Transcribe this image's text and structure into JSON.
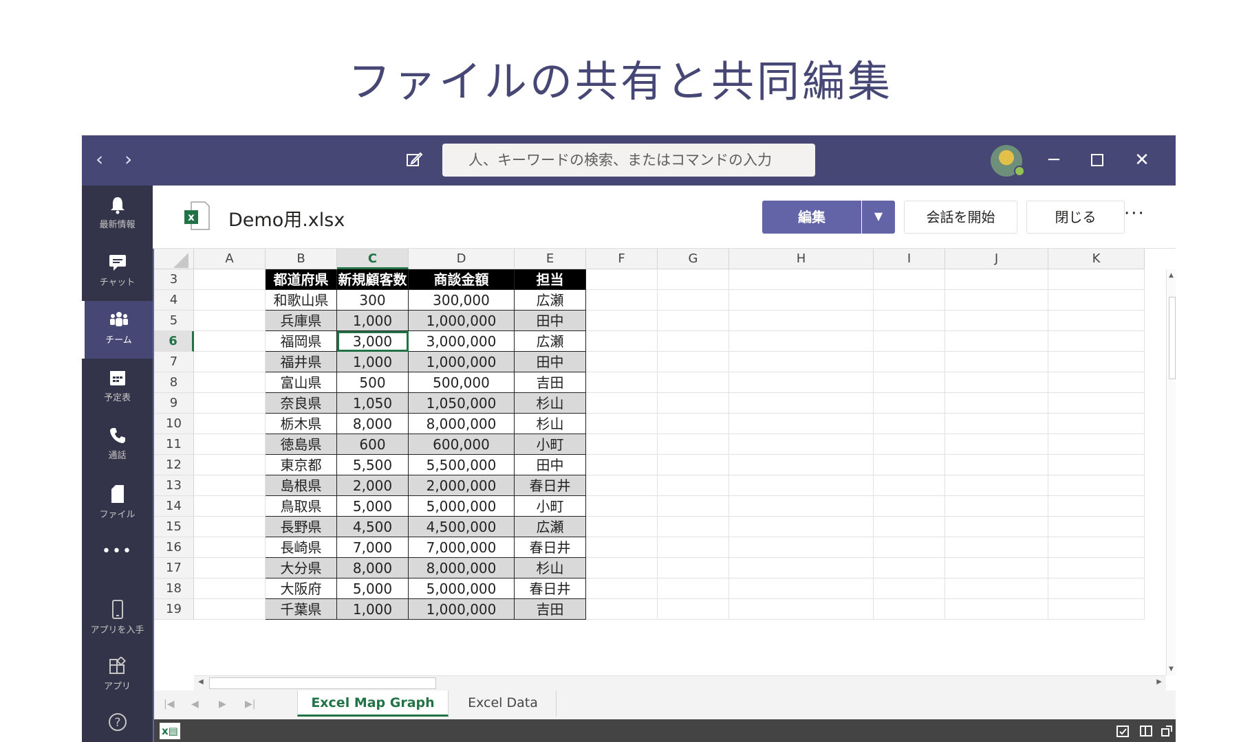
{
  "slide": {
    "title": "ファイルの共有と共同編集"
  },
  "titlebar": {
    "back": "‹",
    "forward": "›",
    "search_placeholder": "人、キーワードの検索、またはコマンドの入力"
  },
  "rail": {
    "items": [
      {
        "label": "最新情報",
        "icon": "bell-icon"
      },
      {
        "label": "チャット",
        "icon": "chat-icon"
      },
      {
        "label": "チーム",
        "icon": "teams-icon"
      },
      {
        "label": "予定表",
        "icon": "calendar-icon"
      },
      {
        "label": "通話",
        "icon": "phone-icon"
      },
      {
        "label": "ファイル",
        "icon": "file-icon"
      },
      {
        "label": "•••",
        "icon": "more-icon"
      },
      {
        "label": "アプリを入手",
        "icon": "mobile-icon"
      },
      {
        "label": "アプリ",
        "icon": "apps-icon"
      },
      {
        "label": "",
        "icon": "help-icon"
      }
    ]
  },
  "file": {
    "name": "Demo用.xlsx",
    "edit_label": "編集",
    "start_chat_label": "会話を開始",
    "close_label": "閉じる",
    "more": "···"
  },
  "sheet": {
    "columns": [
      "A",
      "B",
      "C",
      "D",
      "E",
      "F",
      "G",
      "H",
      "I",
      "J",
      "K"
    ],
    "selected_column": "C",
    "selected_row": "6",
    "rows": [
      "3",
      "4",
      "5",
      "6",
      "7",
      "8",
      "9",
      "10",
      "11",
      "12",
      "13",
      "14",
      "15",
      "16",
      "17",
      "18",
      "19"
    ],
    "header": [
      "都道府県",
      "新規顧客数",
      "商談金額",
      "担当"
    ],
    "data": [
      [
        "和歌山県",
        "300",
        "300,000",
        "広瀬"
      ],
      [
        "兵庫県",
        "1,000",
        "1,000,000",
        "田中"
      ],
      [
        "福岡県",
        "3,000",
        "3,000,000",
        "広瀬"
      ],
      [
        "福井県",
        "1,000",
        "1,000,000",
        "田中"
      ],
      [
        "富山県",
        "500",
        "500,000",
        "吉田"
      ],
      [
        "奈良県",
        "1,050",
        "1,050,000",
        "杉山"
      ],
      [
        "栃木県",
        "8,000",
        "8,000,000",
        "杉山"
      ],
      [
        "徳島県",
        "600",
        "600,000",
        "小町"
      ],
      [
        "東京都",
        "5,500",
        "5,500,000",
        "田中"
      ],
      [
        "島根県",
        "2,000",
        "2,000,000",
        "春日井"
      ],
      [
        "鳥取県",
        "5,000",
        "5,000,000",
        "小町"
      ],
      [
        "長野県",
        "4,500",
        "4,500,000",
        "広瀬"
      ],
      [
        "長崎県",
        "7,000",
        "7,000,000",
        "春日井"
      ],
      [
        "大分県",
        "8,000",
        "8,000,000",
        "杉山"
      ],
      [
        "大阪府",
        "5,000",
        "5,000,000",
        "春日井"
      ],
      [
        "千葉県",
        "1,000",
        "1,000,000",
        "吉田"
      ]
    ],
    "tabs": [
      "Excel Map Graph",
      "Excel Data"
    ],
    "active_tab": "Excel Map Graph"
  },
  "colors": {
    "teams_purple": "#464775",
    "accent": "#6264a7",
    "excel_green": "#217346"
  }
}
